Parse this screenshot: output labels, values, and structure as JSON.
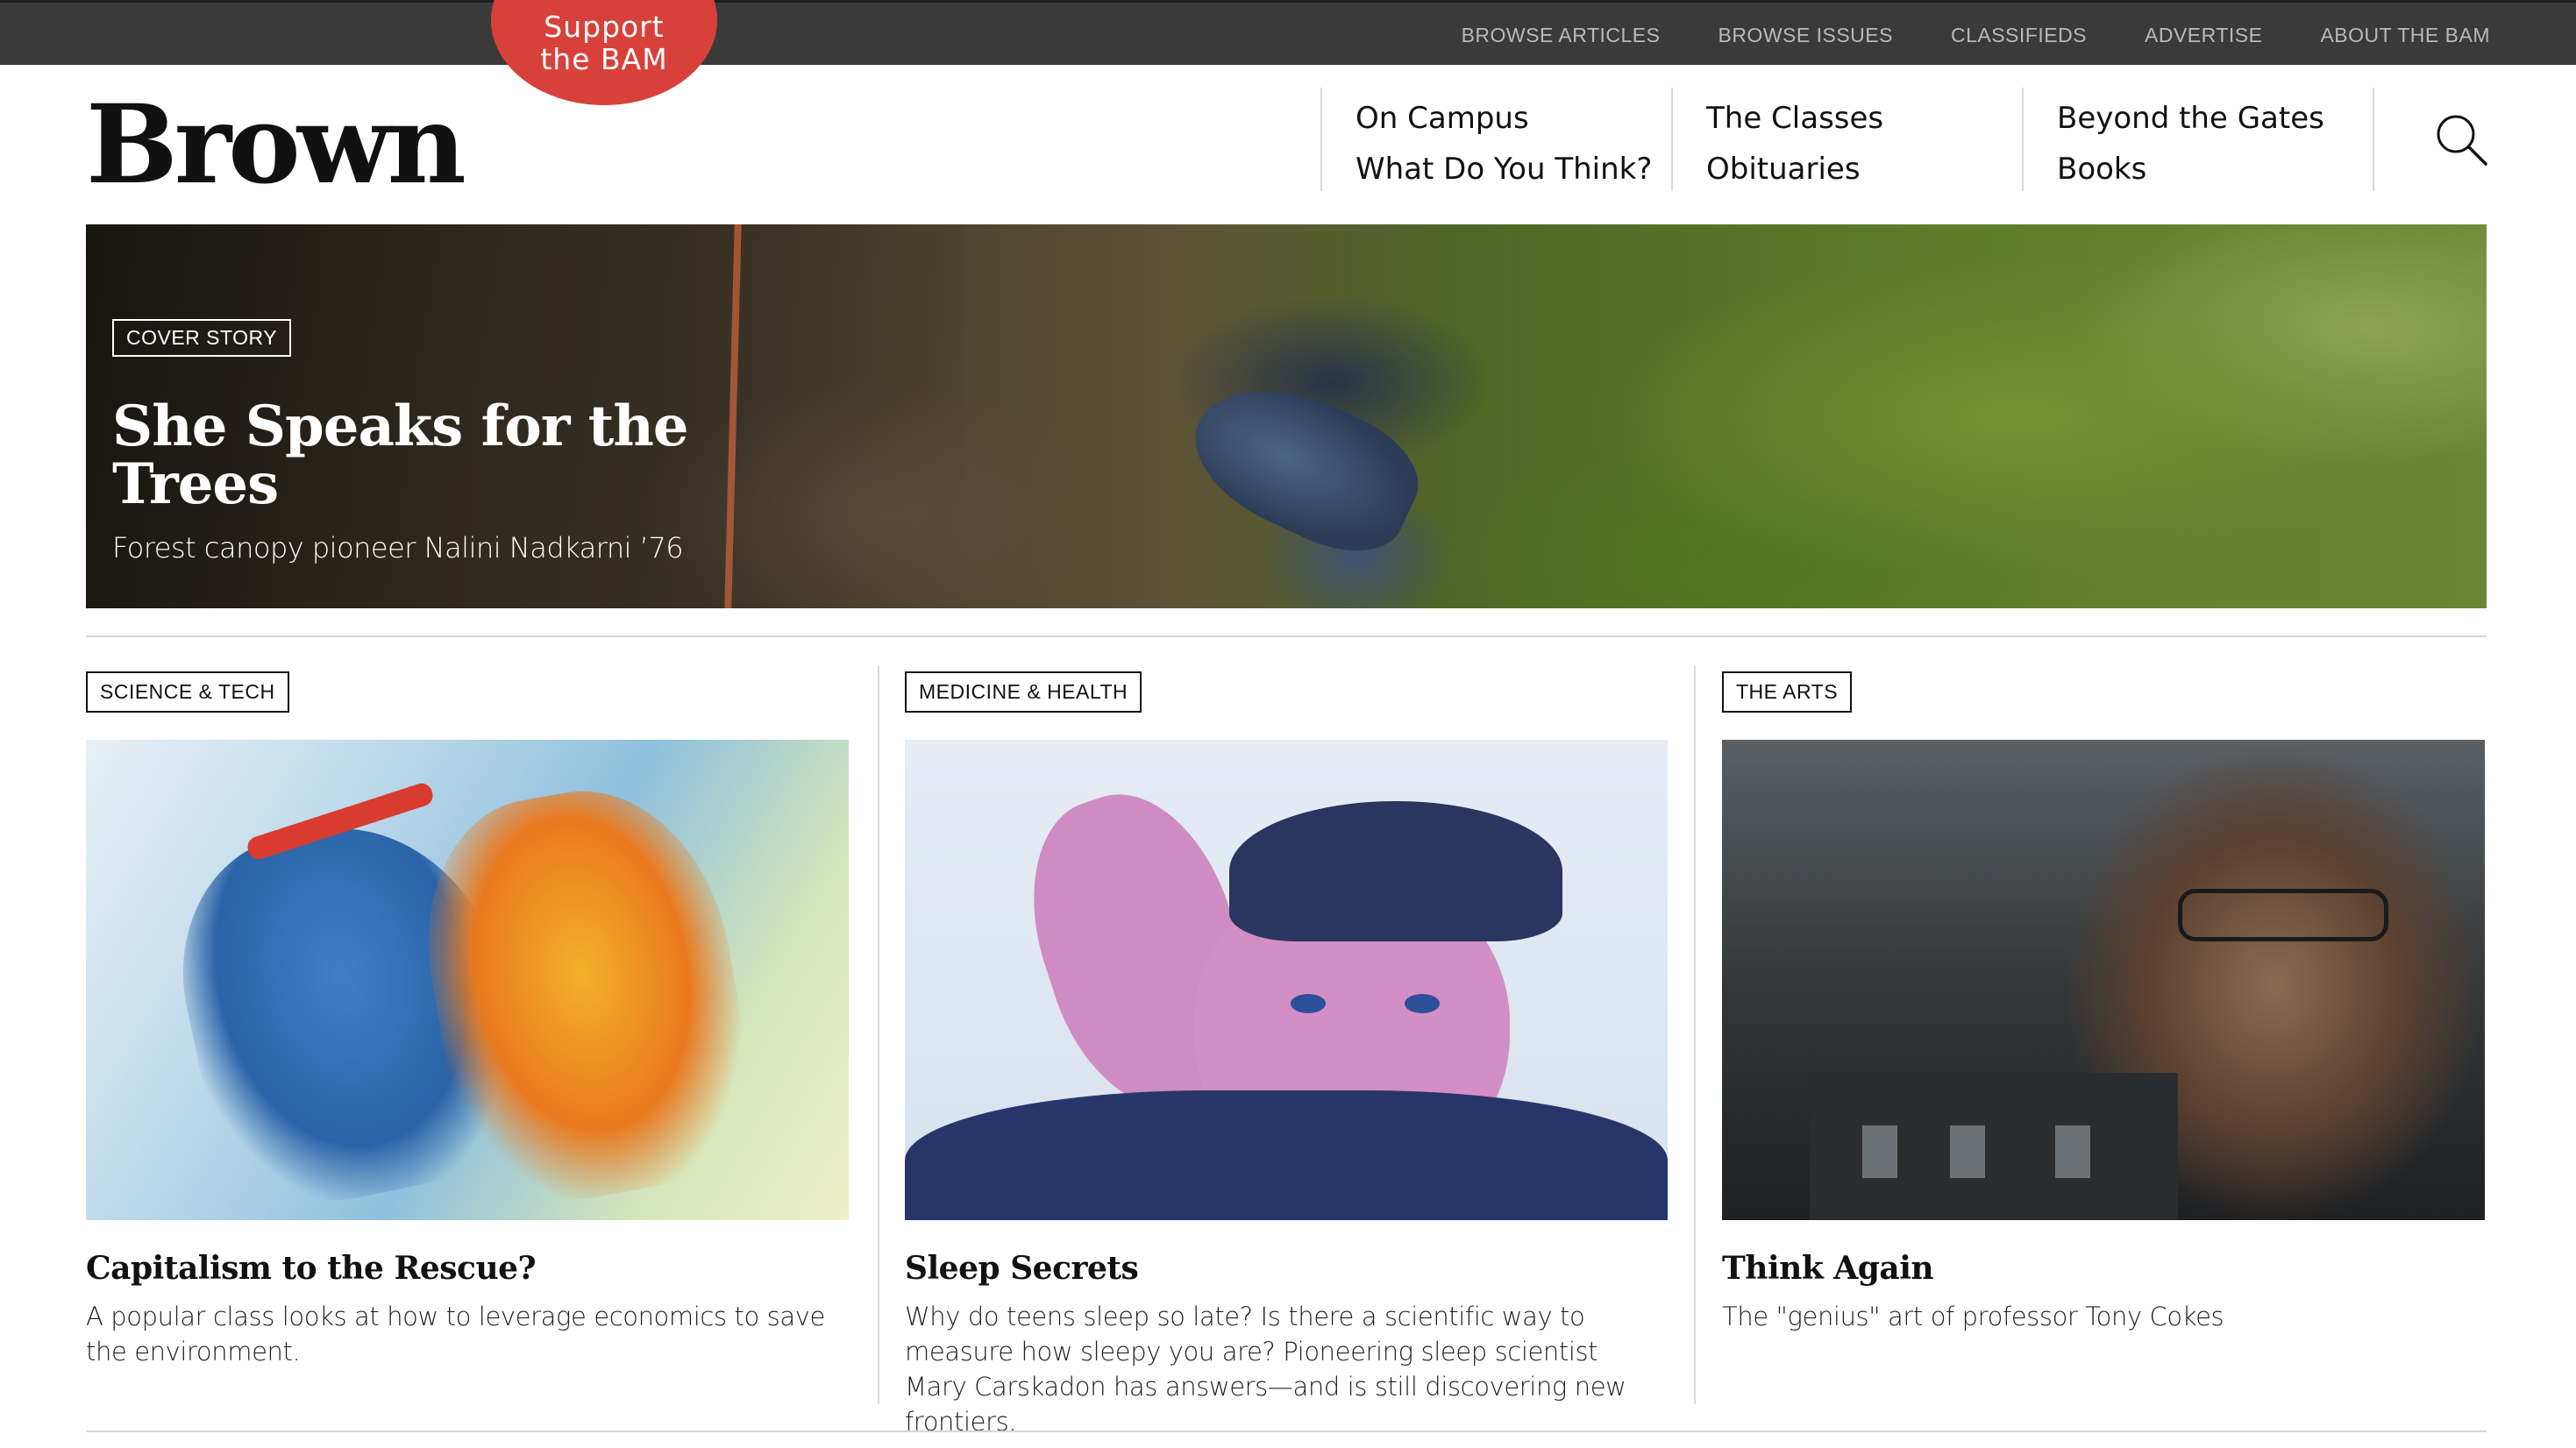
{
  "topnav": {
    "items": [
      "BROWSE ARTICLES",
      "BROWSE ISSUES",
      "CLASSIFIEDS",
      "ADVERTISE",
      "ABOUT THE BAM"
    ]
  },
  "support": {
    "line1": "Support",
    "line2": "the BAM"
  },
  "header": {
    "logo": "Brown",
    "nav": [
      [
        "On Campus",
        "What Do You Think?"
      ],
      [
        "The Classes",
        "Obituaries"
      ],
      [
        "Beyond the Gates",
        "Books"
      ]
    ],
    "search_icon": "search-icon"
  },
  "hero": {
    "tag": "COVER STORY",
    "title": "She Speaks for the Trees",
    "subtitle": "Forest canopy pioneer Nalini Nadkarni ’76"
  },
  "cards": [
    {
      "tag": "SCIENCE & TECH",
      "title": "Capitalism to the Rescue?",
      "description": "A popular class looks at how to leverage economics to save the environment."
    },
    {
      "tag": "MEDICINE & HEALTH",
      "title": "Sleep Secrets",
      "description": "Why do teens sleep so late? Is there a scientific way to measure how sleepy you are? Pioneering sleep scientist Mary Carskadon has answers—and is still discovering new frontiers."
    },
    {
      "tag": "THE ARTS",
      "title": "Think Again",
      "description": "The \"genius\" art of professor Tony Cokes"
    }
  ],
  "colors": {
    "topbar": "#3a3a3a",
    "support_badge": "#d8413a",
    "text": "#111111"
  }
}
